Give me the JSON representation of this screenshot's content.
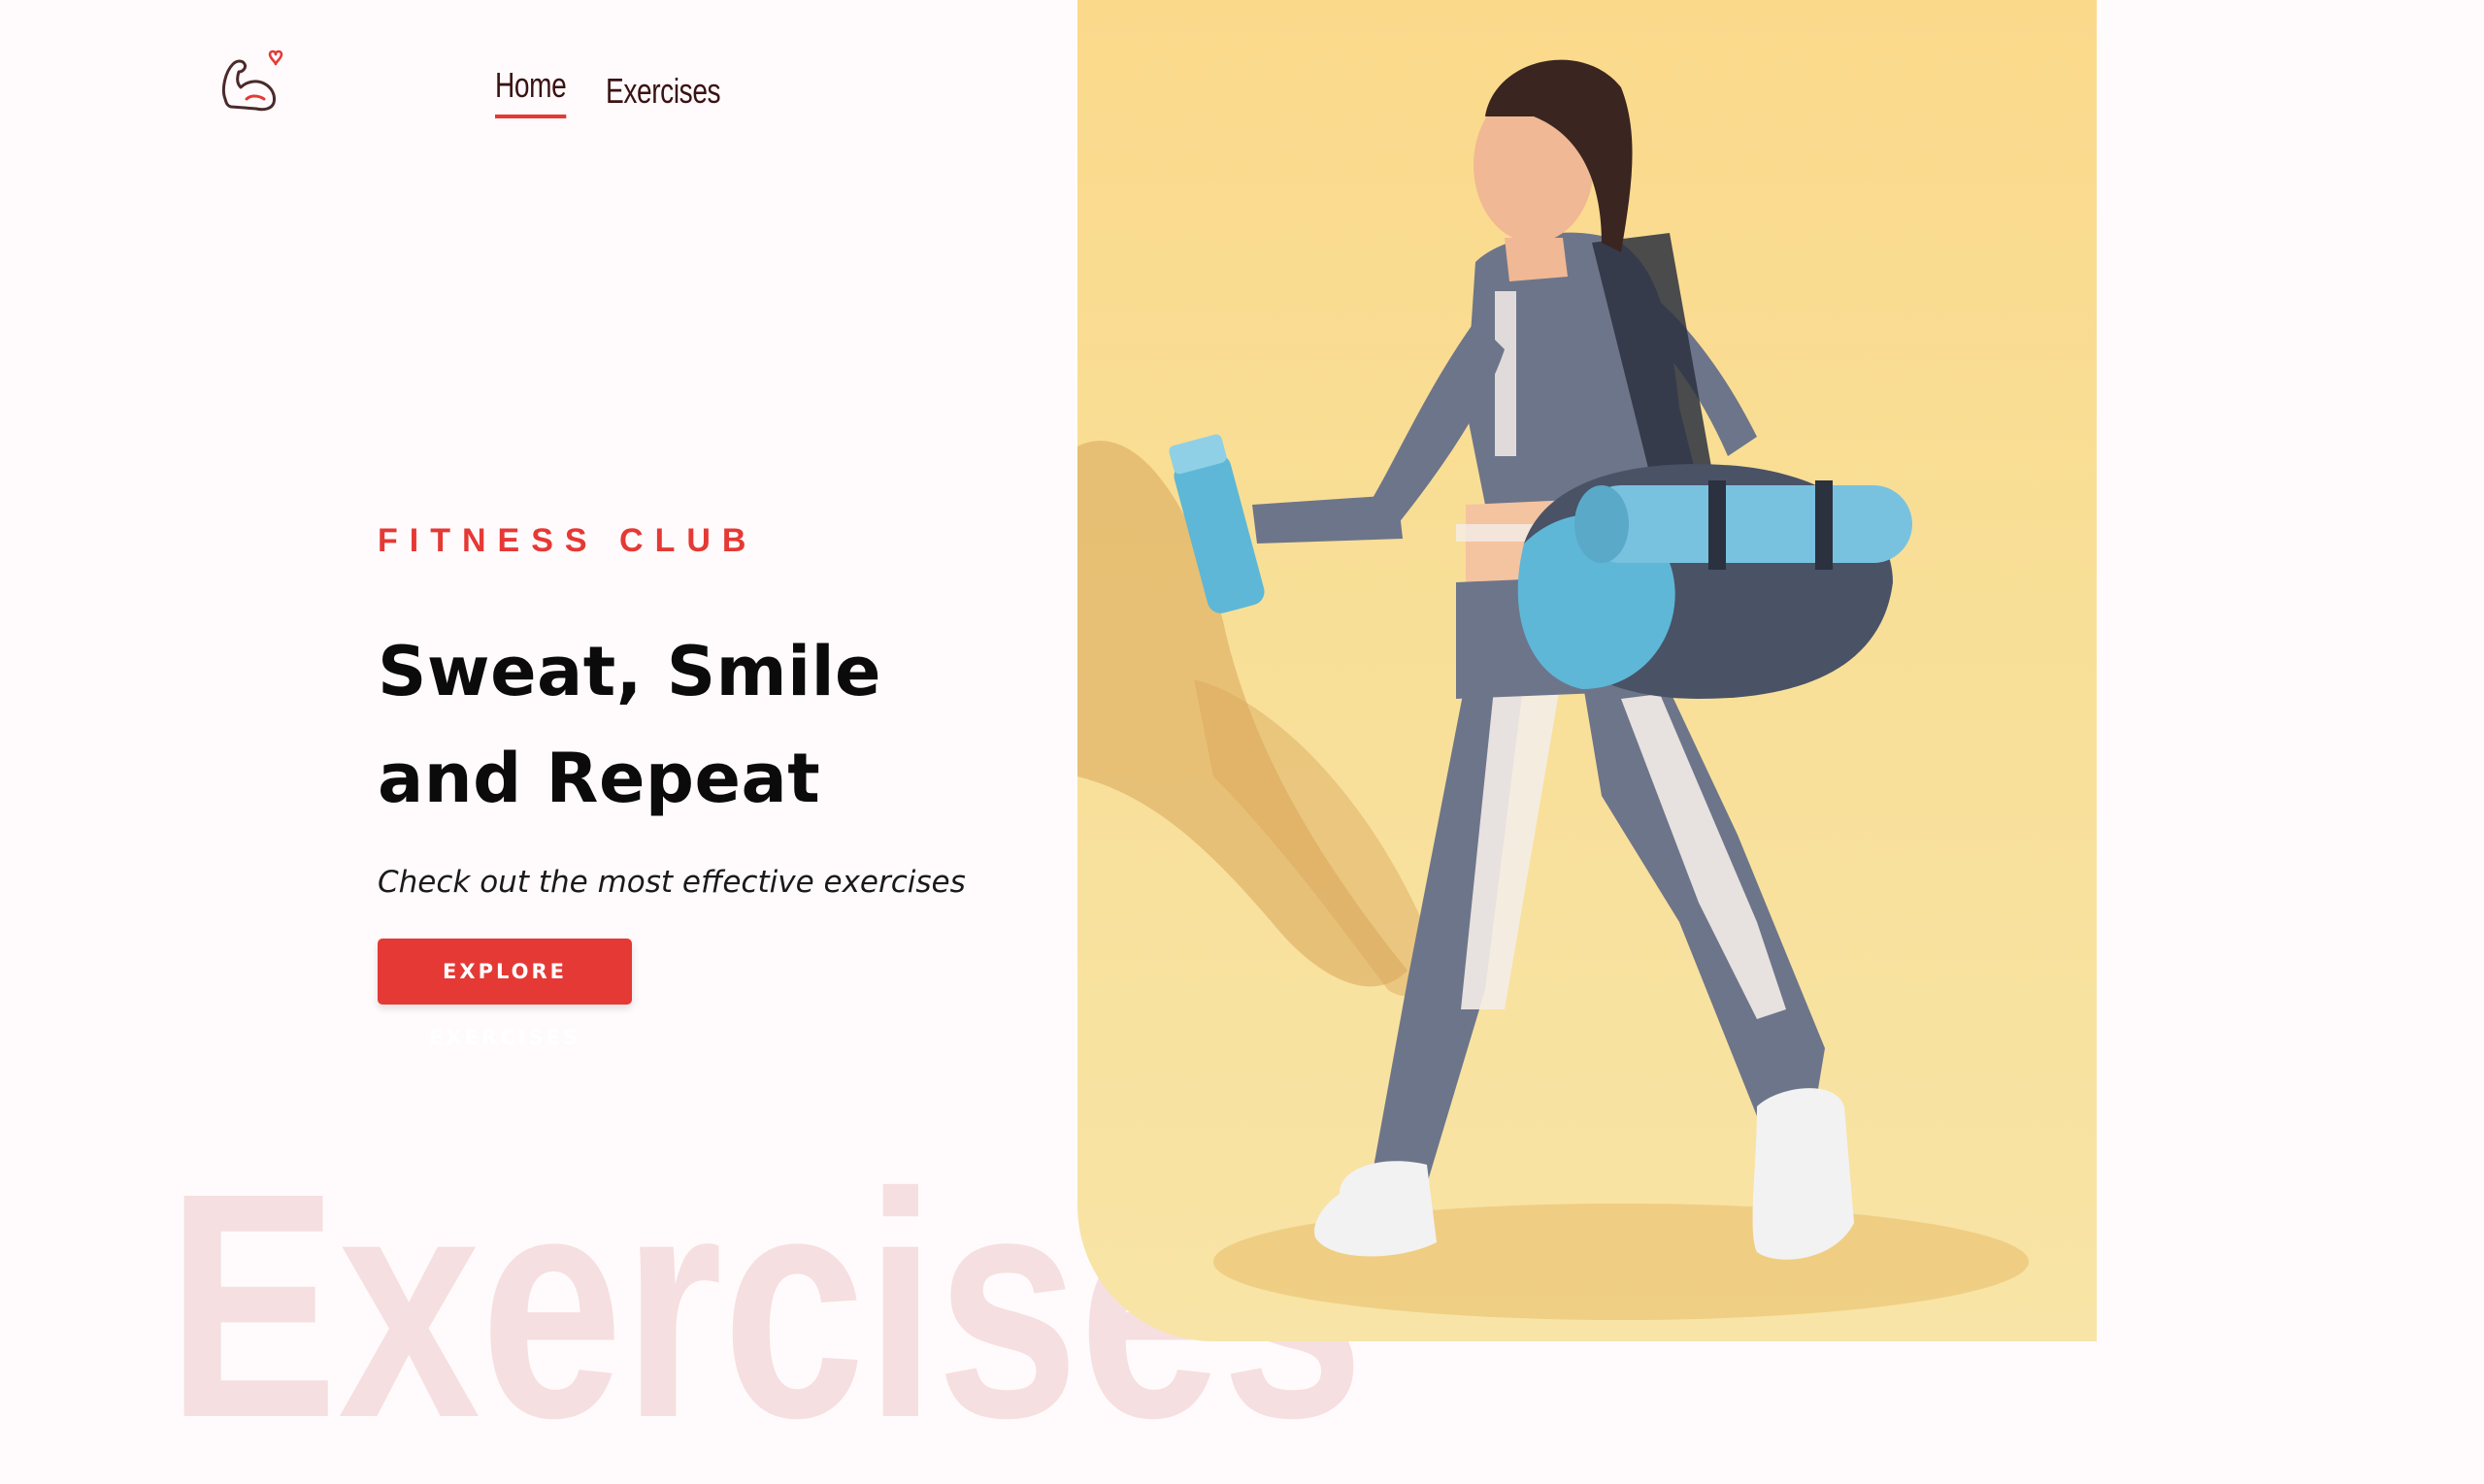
{
  "header": {
    "logo_icon": "flexed-arm-heart-icon",
    "nav": [
      {
        "label": "Home",
        "active": true
      },
      {
        "label": "Exercises",
        "active": false
      }
    ]
  },
  "hero": {
    "eyebrow": "FITNESS CLUB",
    "headline_line1": "Sweat, Smile",
    "headline_line2": "and Repeat",
    "subtitle": "Check out the most effective exercises",
    "cta_label": "EXPLORE EXERCISES"
  },
  "watermark": "Exercises",
  "colors": {
    "accent": "#e53935",
    "background": "#fffbfc",
    "banner": "#fbd98b",
    "watermark": "#f6dfe0"
  }
}
